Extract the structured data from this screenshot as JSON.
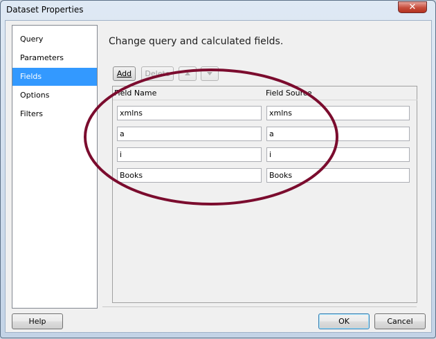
{
  "window": {
    "title": "Dataset Properties",
    "close_glyph": "✕"
  },
  "nav": {
    "items": [
      {
        "label": "Query",
        "selected": false
      },
      {
        "label": "Parameters",
        "selected": false
      },
      {
        "label": "Fields",
        "selected": true
      },
      {
        "label": "Options",
        "selected": false
      },
      {
        "label": "Filters",
        "selected": false
      }
    ]
  },
  "main": {
    "heading": "Change query and calculated fields.",
    "toolbar": {
      "add_label": "Add",
      "delete_label": "Delete"
    },
    "grid": {
      "columns": [
        "Field Name",
        "Field Source"
      ],
      "rows": [
        [
          "xmlns",
          "xmlns"
        ],
        [
          "a",
          "a"
        ],
        [
          "i",
          "i"
        ],
        [
          "Books",
          "Books"
        ]
      ]
    }
  },
  "footer": {
    "help_label": "Help",
    "ok_label": "OK",
    "cancel_label": "Cancel"
  },
  "colors": {
    "selection": "#3399ff",
    "annotation": "#7b0c2e"
  }
}
